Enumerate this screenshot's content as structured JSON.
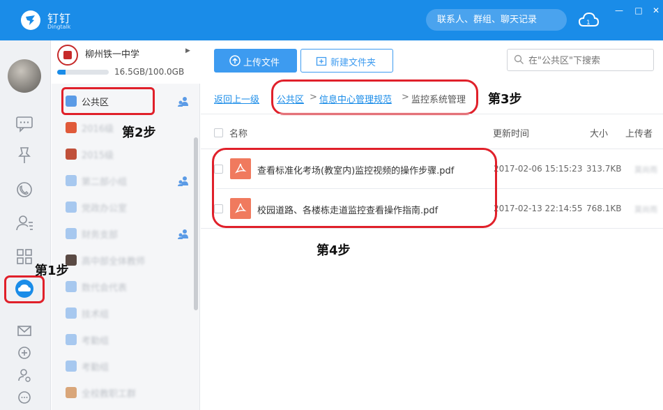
{
  "app": {
    "name": "钉钉",
    "subtitle": "Dingtalk",
    "search_placeholder": "联系人、群组、聊天记录",
    "window_controls": [
      "—",
      "□",
      "✕"
    ]
  },
  "org": {
    "name": "柳州铁一中学",
    "quota_text": "16.5GB/100.0GB",
    "quota_fraction": 0.165
  },
  "folders": [
    {
      "label": "公共区",
      "shared": true,
      "blurred": false,
      "icon_color": "#5b9be6"
    },
    {
      "label": "2016级",
      "shared": false,
      "blurred": true,
      "icon_color": "#e05a3a"
    },
    {
      "label": "2015级",
      "shared": false,
      "blurred": true,
      "icon_color": "#c0503a"
    },
    {
      "label": "第二部小组",
      "shared": true,
      "blurred": true,
      "icon_color": "#a7c8ef"
    },
    {
      "label": "党政办公室",
      "shared": false,
      "blurred": true,
      "icon_color": "#a7c8ef"
    },
    {
      "label": "财务支部",
      "shared": true,
      "blurred": true,
      "icon_color": "#a7c8ef"
    },
    {
      "label": "高中部全体教师",
      "shared": false,
      "blurred": true,
      "icon_color": "#5a4a44"
    },
    {
      "label": "数代会代表",
      "shared": false,
      "blurred": true,
      "icon_color": "#a7c8ef"
    },
    {
      "label": "技术组",
      "shared": false,
      "blurred": true,
      "icon_color": "#a7c8ef"
    },
    {
      "label": "考勤组",
      "shared": false,
      "blurred": true,
      "icon_color": "#a7c8ef"
    },
    {
      "label": "考勤组",
      "shared": false,
      "blurred": true,
      "icon_color": "#a7c8ef"
    },
    {
      "label": "全校教职工群",
      "shared": false,
      "blurred": true,
      "icon_color": "#d9a67a"
    }
  ],
  "toolbar": {
    "upload_label": "上传文件",
    "new_folder_label": "新建文件夹",
    "search_placeholder": "在\"公共区\"下搜索"
  },
  "breadcrumb": {
    "back": "返回上一级",
    "sep": ">",
    "items": [
      "公共区",
      "信息中心管理规范",
      "监控系统管理"
    ]
  },
  "table": {
    "headers": {
      "name": "名称",
      "updated": "更新时间",
      "size": "大小",
      "uploader": "上传者"
    },
    "rows": [
      {
        "name": "查看标准化考场(教室内)监控视频的操作步骤.pdf",
        "updated": "2017-02-06 15:15:23",
        "size": "313.7KB",
        "uploader": "莫尚雨"
      },
      {
        "name": "校园道路、各楼栋走道监控查看操作指南.pdf",
        "updated": "2017-02-13 22:14:55",
        "size": "768.1KB",
        "uploader": "莫尚雨"
      }
    ]
  },
  "annotations": {
    "step1": "第1步",
    "step2": "第2步",
    "step3": "第3步",
    "step4": "第4步",
    "highlight_color": "#e0202a"
  },
  "colors": {
    "brand": "#1a8ce8",
    "pdf": "#f07a5e"
  }
}
